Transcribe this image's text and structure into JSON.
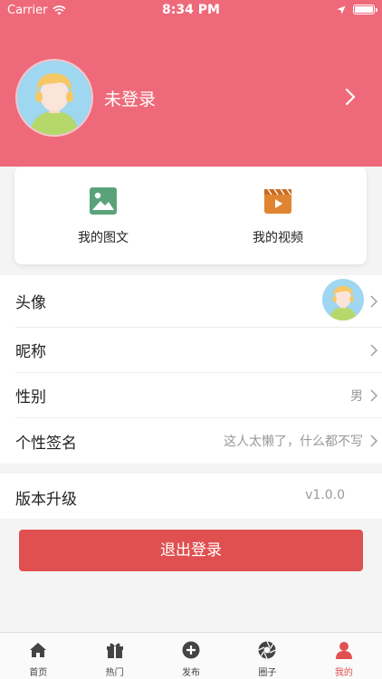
{
  "status_bar": {
    "carrier": "Carrier",
    "time": "8:34 PM"
  },
  "profile": {
    "login_status": "未登录"
  },
  "shortcuts": [
    {
      "label": "我的图文",
      "icon": "image-icon",
      "color": "#5aa37a"
    },
    {
      "label": "我的视频",
      "icon": "video-icon",
      "color": "#e08432"
    }
  ],
  "settings": {
    "avatar_label": "头像",
    "nickname_label": "昵称",
    "gender_label": "性别",
    "gender_value": "男",
    "signature_label": "个性签名",
    "signature_value": "这人太懒了，什么都不写",
    "version_label": "版本升级",
    "version_value": "v1.0.0"
  },
  "logout_label": "退出登录",
  "tabs": [
    {
      "label": "首页",
      "icon": "home-icon"
    },
    {
      "label": "热门",
      "icon": "gift-icon"
    },
    {
      "label": "发布",
      "icon": "add-circle-icon"
    },
    {
      "label": "圈子",
      "icon": "aperture-icon"
    },
    {
      "label": "我的",
      "icon": "user-icon",
      "active": true
    }
  ],
  "colors": {
    "header": "#ee6a7a",
    "accent": "#e05050"
  }
}
